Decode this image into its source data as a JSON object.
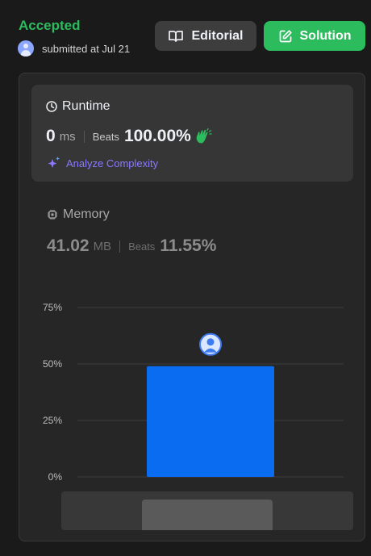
{
  "header": {
    "status": "Accepted",
    "submitted_text": "submitted at Jul 21",
    "editorial_label": "Editorial",
    "solution_label": "Solution"
  },
  "runtime": {
    "title": "Runtime",
    "value": "0",
    "unit": "ms",
    "beats_label": "Beats",
    "beats_value": "100.00%",
    "analyze_label": "Analyze Complexity"
  },
  "memory": {
    "title": "Memory",
    "value": "41.02",
    "unit": "MB",
    "beats_label": "Beats",
    "beats_value": "11.55%"
  },
  "colors": {
    "accepted": "#2cbb5d",
    "bar": "#0a6cf0",
    "analyze": "#8a79ff",
    "clap": "#2cbb5d"
  },
  "icons": [
    "book-icon",
    "edit-icon",
    "clock-icon",
    "clap-icon",
    "sparkle-icon",
    "chip-icon",
    "avatar-icon"
  ],
  "chart_data": {
    "type": "bar",
    "categories": [
      ""
    ],
    "values": [
      49
    ],
    "ylim": [
      0,
      75
    ],
    "yticks": [
      "0%",
      "25%",
      "50%",
      "75%"
    ],
    "grid": true
  }
}
